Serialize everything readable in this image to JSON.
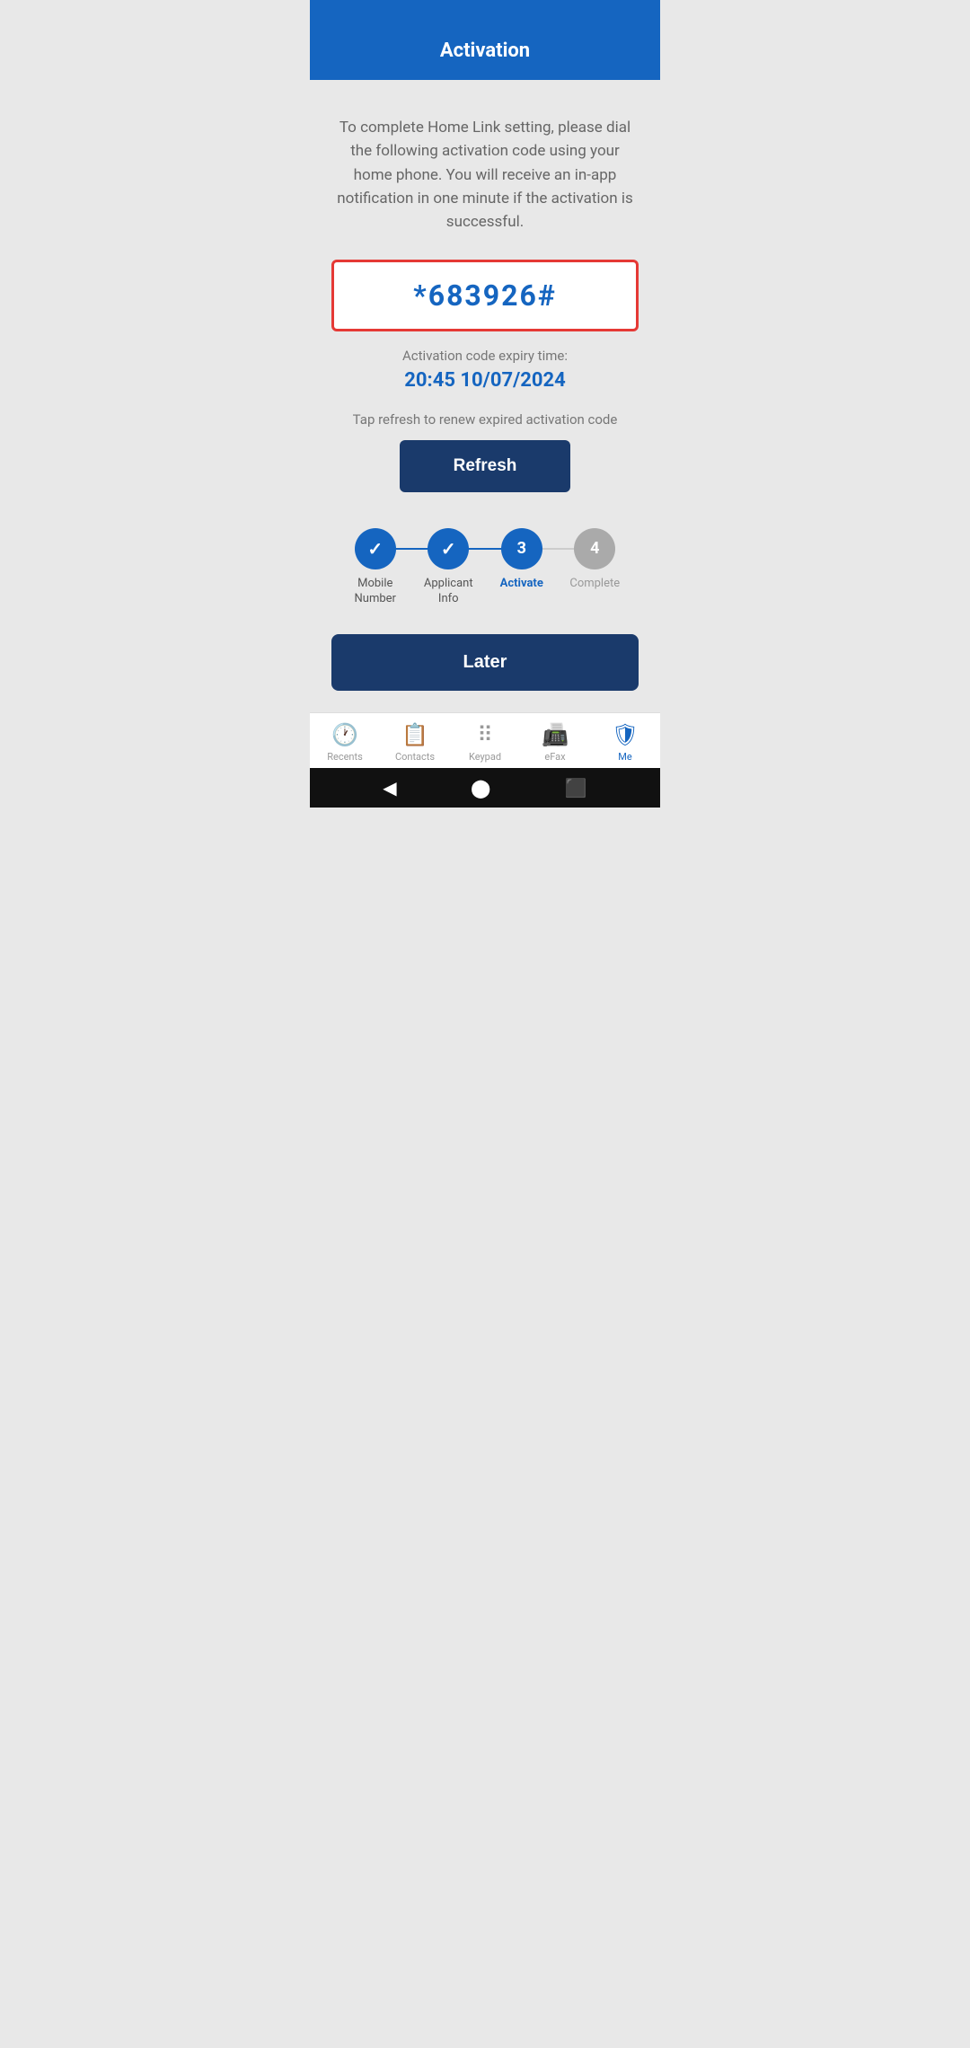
{
  "header": {
    "title": "Activation"
  },
  "content": {
    "instruction": "To complete Home Link setting, please dial the following activation code using your home phone. You will receive an in-app notification in one minute if the activation is successful.",
    "activation_code": "*683926#",
    "expiry_label": "Activation code expiry time:",
    "expiry_time": "20:45 10/07/2024",
    "tap_refresh_text": "Tap refresh to renew expired activation code",
    "refresh_button_label": "Refresh"
  },
  "stepper": {
    "steps": [
      {
        "id": 1,
        "label": "Mobile\nNumber",
        "state": "completed"
      },
      {
        "id": 2,
        "label": "Applicant\nInfo",
        "state": "completed"
      },
      {
        "id": 3,
        "label": "Activate",
        "state": "active"
      },
      {
        "id": 4,
        "label": "Complete",
        "state": "inactive"
      }
    ]
  },
  "later_button_label": "Later",
  "bottom_nav": {
    "items": [
      {
        "id": "recents",
        "label": "Recents",
        "active": false
      },
      {
        "id": "contacts",
        "label": "Contacts",
        "active": false
      },
      {
        "id": "keypad",
        "label": "Keypad",
        "active": false
      },
      {
        "id": "efax",
        "label": "eFax",
        "active": false
      },
      {
        "id": "me",
        "label": "Me",
        "active": true
      }
    ]
  }
}
